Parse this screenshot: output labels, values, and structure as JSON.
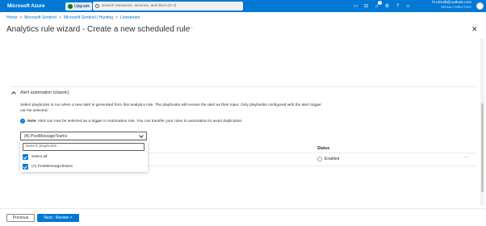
{
  "topbar": {
    "brand": "Microsoft Azure",
    "upgrade_label": "Upgrade",
    "search_placeholder": "Search resources, services, and docs (G+/)",
    "notification_count": "1",
    "user_name": "hi.rahulb@outlook.com",
    "user_directory": "DEFAULT DIRECTORY"
  },
  "breadcrumb": [
    "Home",
    "Microsoft Sentinel",
    "Microsoft Sentinel | Hunting",
    "Livestream"
  ],
  "page": {
    "title": "Analytics rule wizard - Create a new scheduled rule",
    "more_label": "···",
    "close_label": "✕"
  },
  "section": {
    "title": "Alert automation (classic)",
    "description": "Select playbooks to run when a new alert is generated from this analytics rule. The playbooks will receive the alert as their input. Only playbooks configured with the alert trigger can be selected.",
    "note_label": "Note",
    "note_text": "Alert can now be selected as a trigger in Automation rule. You can transfer your rules to automation to avoid duplication."
  },
  "dropdown": {
    "selected": "(A) PostMessageTeams",
    "search_placeholder": "Search playbooks",
    "options": [
      {
        "label": "Select all",
        "checked": true
      },
      {
        "label": "(A) PostMessageTeams",
        "checked": true
      }
    ]
  },
  "table": {
    "status_header": "Status",
    "row_status": "Enabled",
    "row_more": "···"
  },
  "footer": {
    "previous_label": "Previous",
    "next_label": "Next : Review >"
  },
  "colors": {
    "accent": "#0078d4"
  }
}
